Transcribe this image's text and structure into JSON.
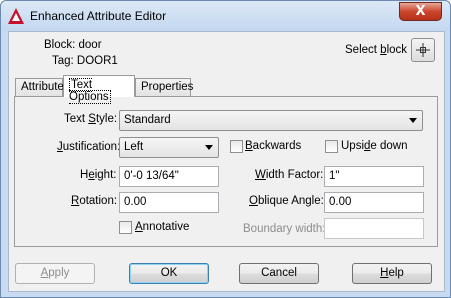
{
  "window": {
    "title": "Enhanced Attribute Editor",
    "close_glyph": "X"
  },
  "header": {
    "block_label": "Block: door",
    "tag_label": "Tag: DOOR1",
    "select_block_label_pre": "Select ",
    "select_block_label_ul": "b",
    "select_block_label_post": "lock",
    "select_block_icon": "crosshair-icon"
  },
  "tabs": [
    {
      "label": "Attribute"
    },
    {
      "label": "Text Options"
    },
    {
      "label": "Properties"
    }
  ],
  "text_options": {
    "text_style": {
      "label_pre": "Text ",
      "label_ul": "S",
      "label_post": "tyle:",
      "value": "Standard"
    },
    "justification": {
      "label_ul": "J",
      "label_post": "ustification:",
      "value": "Left"
    },
    "backwards": {
      "label_ul": "B",
      "label_post": "ackwards",
      "checked": false
    },
    "upside_down": {
      "label_pre": "Upsi",
      "label_ul": "d",
      "label_post": "e down",
      "checked": false
    },
    "height": {
      "label_pre": "H",
      "label_ul": "e",
      "label_post": "ight:",
      "value": "0'-0 13/64\""
    },
    "width_factor": {
      "label_ul": "W",
      "label_post": "idth Factor:",
      "value": "1\""
    },
    "rotation": {
      "label_ul": "R",
      "label_post": "otation:",
      "value": "0.00"
    },
    "oblique_angle": {
      "label_pre": "",
      "label_ul": "O",
      "label_post": "blique Angle:",
      "value": "0.00"
    },
    "annotative": {
      "label_ul": "A",
      "label_post": "nnotative",
      "checked": false
    },
    "boundary_width": {
      "label": "Boundary width:",
      "value": ""
    }
  },
  "buttons": {
    "apply_ul": "A",
    "apply_post": "pply",
    "ok": "OK",
    "cancel": "Cancel",
    "help_ul": "H",
    "help_post": "elp"
  },
  "colors": {
    "frame": "#c8daf0",
    "close_button": "#c9462c",
    "app_icon_red": "#c8102e"
  }
}
